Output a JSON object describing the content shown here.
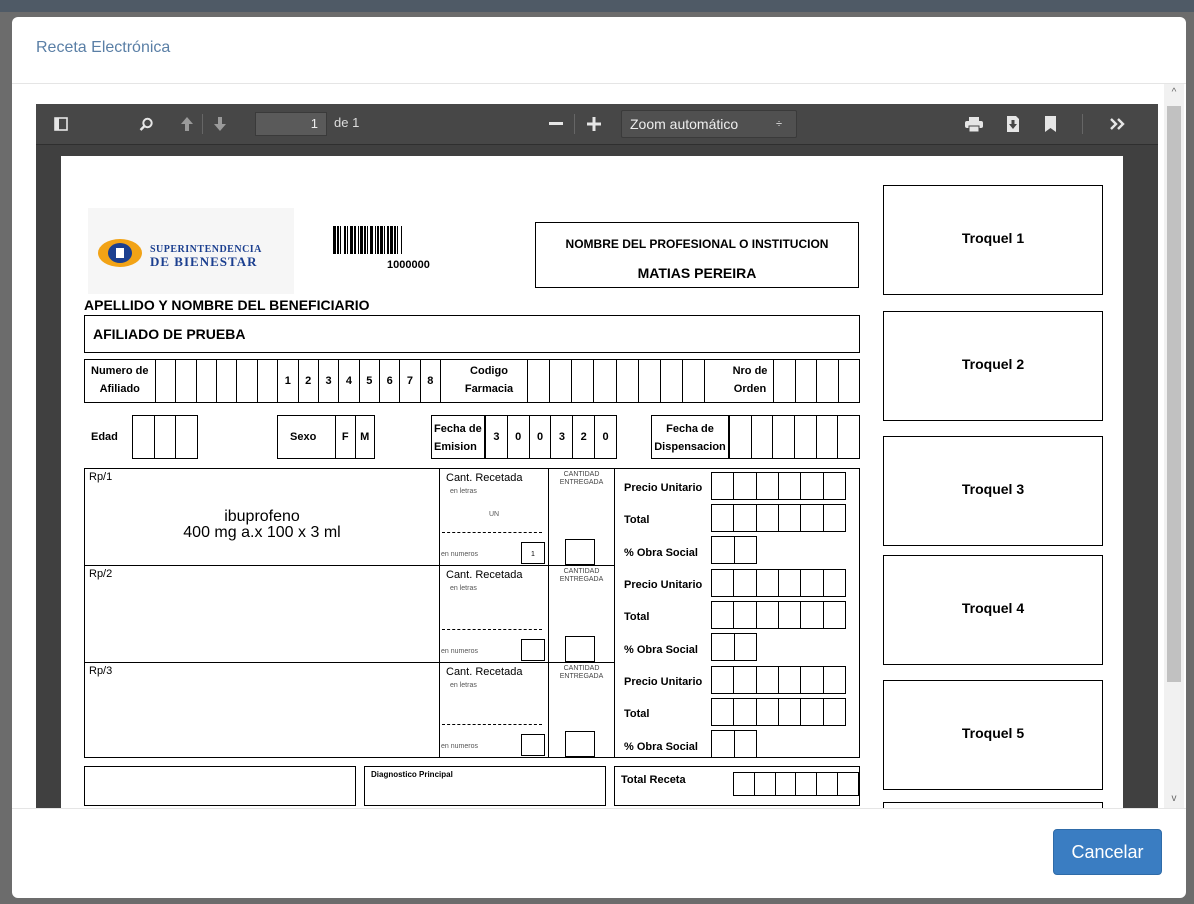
{
  "modal": {
    "title": "Receta Electrónica",
    "cancel_label": "Cancelar"
  },
  "viewer": {
    "page_number": "1",
    "page_of": "de 1",
    "zoom_label": "Zoom automático",
    "icons": [
      "sidebar-toggle-icon",
      "search-icon",
      "previous-page-icon",
      "next-page-icon",
      "zoom-out-icon",
      "zoom-in-icon",
      "print-icon",
      "download-icon",
      "bookmark-icon",
      "tools-icon"
    ]
  },
  "prescription": {
    "logo_line1": "SUPERINTENDENCIA",
    "logo_line2": "DE BIENESTAR",
    "barcode_number": "1000000",
    "professional_label": "NOMBRE DEL PROFESIONAL O INSTITUCION",
    "professional_name": "MATIAS PEREIRA",
    "beneficiary_label": "APELLIDO Y NOMBRE DEL BENEFICIARIO",
    "beneficiary_name": "AFILIADO DE PRUEBA",
    "numero_afiliado_l1": "Numero de",
    "numero_afiliado_l2": "Afiliado",
    "afiliado_digits": [
      "",
      "",
      "",
      "",
      "",
      "",
      "1",
      "2",
      "3",
      "4",
      "5",
      "6",
      "7",
      "8"
    ],
    "codigo_farmacia_l1": "Codigo",
    "codigo_farmacia_l2": "Farmacia",
    "nro_orden_l1": "Nro de",
    "nro_orden_l2": "Orden",
    "edad_label": "Edad",
    "sexo_label": "Sexo",
    "sexo_f": "F",
    "sexo_m": "M",
    "fecha_emision_l1": "Fecha de",
    "fecha_emision_l2": "Emision",
    "fecha_emision_digits": [
      "3",
      "0",
      "0",
      "3",
      "2",
      "0"
    ],
    "fecha_disp_l1": "Fecha de",
    "fecha_disp_l2": "Dispensacion",
    "rp1_label": "Rp/1",
    "rp1_drug_line1": "ibuprofeno",
    "rp1_drug_line2": "400 mg a.x 100 x 3 ml",
    "rp2_label": "Rp/2",
    "rp3_label": "Rp/3",
    "cant_recetada": "Cant. Recetada",
    "en_letras": "en letras",
    "en_numeros": "en numeros",
    "cantidad_l1": "CANTIDAD",
    "cantidad_l2": "ENTREGADA",
    "rp1_letras_value": "UN",
    "rp1_numeros_value": "1",
    "precio_unitario": "Precio Unitario",
    "total": "Total",
    "obra_social": "% Obra Social",
    "diagnostico": "Diagnostico Principal",
    "total_receta": "Total Receta",
    "troquel_labels": [
      "Troquel 1",
      "Troquel 2",
      "Troquel 3",
      "Troquel 4",
      "Troquel 5"
    ]
  },
  "colors": {
    "title_blue": "#5a7fa6",
    "button_blue": "#3a7dc2",
    "toolbar": "#474747"
  }
}
